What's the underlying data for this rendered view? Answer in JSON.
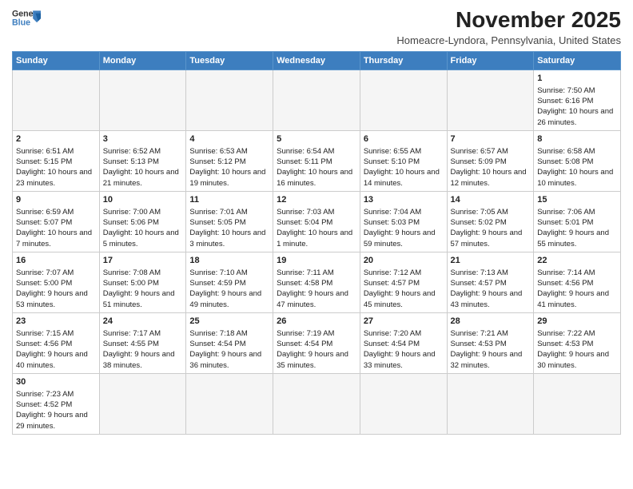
{
  "header": {
    "logo_line1": "General",
    "logo_line2": "Blue",
    "main_title": "November 2025",
    "subtitle": "Homeacre-Lyndora, Pennsylvania, United States"
  },
  "weekdays": [
    "Sunday",
    "Monday",
    "Tuesday",
    "Wednesday",
    "Thursday",
    "Friday",
    "Saturday"
  ],
  "weeks": [
    [
      {
        "day": "",
        "info": ""
      },
      {
        "day": "",
        "info": ""
      },
      {
        "day": "",
        "info": ""
      },
      {
        "day": "",
        "info": ""
      },
      {
        "day": "",
        "info": ""
      },
      {
        "day": "",
        "info": ""
      },
      {
        "day": "1",
        "info": "Sunrise: 7:50 AM\nSunset: 6:16 PM\nDaylight: 10 hours\nand 26 minutes."
      }
    ],
    [
      {
        "day": "2",
        "info": "Sunrise: 6:51 AM\nSunset: 5:15 PM\nDaylight: 10 hours\nand 23 minutes."
      },
      {
        "day": "3",
        "info": "Sunrise: 6:52 AM\nSunset: 5:13 PM\nDaylight: 10 hours\nand 21 minutes."
      },
      {
        "day": "4",
        "info": "Sunrise: 6:53 AM\nSunset: 5:12 PM\nDaylight: 10 hours\nand 19 minutes."
      },
      {
        "day": "5",
        "info": "Sunrise: 6:54 AM\nSunset: 5:11 PM\nDaylight: 10 hours\nand 16 minutes."
      },
      {
        "day": "6",
        "info": "Sunrise: 6:55 AM\nSunset: 5:10 PM\nDaylight: 10 hours\nand 14 minutes."
      },
      {
        "day": "7",
        "info": "Sunrise: 6:57 AM\nSunset: 5:09 PM\nDaylight: 10 hours\nand 12 minutes."
      },
      {
        "day": "8",
        "info": "Sunrise: 6:58 AM\nSunset: 5:08 PM\nDaylight: 10 hours\nand 10 minutes."
      }
    ],
    [
      {
        "day": "9",
        "info": "Sunrise: 6:59 AM\nSunset: 5:07 PM\nDaylight: 10 hours\nand 7 minutes."
      },
      {
        "day": "10",
        "info": "Sunrise: 7:00 AM\nSunset: 5:06 PM\nDaylight: 10 hours\nand 5 minutes."
      },
      {
        "day": "11",
        "info": "Sunrise: 7:01 AM\nSunset: 5:05 PM\nDaylight: 10 hours\nand 3 minutes."
      },
      {
        "day": "12",
        "info": "Sunrise: 7:03 AM\nSunset: 5:04 PM\nDaylight: 10 hours\nand 1 minute."
      },
      {
        "day": "13",
        "info": "Sunrise: 7:04 AM\nSunset: 5:03 PM\nDaylight: 9 hours\nand 59 minutes."
      },
      {
        "day": "14",
        "info": "Sunrise: 7:05 AM\nSunset: 5:02 PM\nDaylight: 9 hours\nand 57 minutes."
      },
      {
        "day": "15",
        "info": "Sunrise: 7:06 AM\nSunset: 5:01 PM\nDaylight: 9 hours\nand 55 minutes."
      }
    ],
    [
      {
        "day": "16",
        "info": "Sunrise: 7:07 AM\nSunset: 5:00 PM\nDaylight: 9 hours\nand 53 minutes."
      },
      {
        "day": "17",
        "info": "Sunrise: 7:08 AM\nSunset: 5:00 PM\nDaylight: 9 hours\nand 51 minutes."
      },
      {
        "day": "18",
        "info": "Sunrise: 7:10 AM\nSunset: 4:59 PM\nDaylight: 9 hours\nand 49 minutes."
      },
      {
        "day": "19",
        "info": "Sunrise: 7:11 AM\nSunset: 4:58 PM\nDaylight: 9 hours\nand 47 minutes."
      },
      {
        "day": "20",
        "info": "Sunrise: 7:12 AM\nSunset: 4:57 PM\nDaylight: 9 hours\nand 45 minutes."
      },
      {
        "day": "21",
        "info": "Sunrise: 7:13 AM\nSunset: 4:57 PM\nDaylight: 9 hours\nand 43 minutes."
      },
      {
        "day": "22",
        "info": "Sunrise: 7:14 AM\nSunset: 4:56 PM\nDaylight: 9 hours\nand 41 minutes."
      }
    ],
    [
      {
        "day": "23",
        "info": "Sunrise: 7:15 AM\nSunset: 4:56 PM\nDaylight: 9 hours\nand 40 minutes."
      },
      {
        "day": "24",
        "info": "Sunrise: 7:17 AM\nSunset: 4:55 PM\nDaylight: 9 hours\nand 38 minutes."
      },
      {
        "day": "25",
        "info": "Sunrise: 7:18 AM\nSunset: 4:54 PM\nDaylight: 9 hours\nand 36 minutes."
      },
      {
        "day": "26",
        "info": "Sunrise: 7:19 AM\nSunset: 4:54 PM\nDaylight: 9 hours\nand 35 minutes."
      },
      {
        "day": "27",
        "info": "Sunrise: 7:20 AM\nSunset: 4:54 PM\nDaylight: 9 hours\nand 33 minutes."
      },
      {
        "day": "28",
        "info": "Sunrise: 7:21 AM\nSunset: 4:53 PM\nDaylight: 9 hours\nand 32 minutes."
      },
      {
        "day": "29",
        "info": "Sunrise: 7:22 AM\nSunset: 4:53 PM\nDaylight: 9 hours\nand 30 minutes."
      }
    ],
    [
      {
        "day": "30",
        "info": "Sunrise: 7:23 AM\nSunset: 4:52 PM\nDaylight: 9 hours\nand 29 minutes."
      },
      {
        "day": "",
        "info": ""
      },
      {
        "day": "",
        "info": ""
      },
      {
        "day": "",
        "info": ""
      },
      {
        "day": "",
        "info": ""
      },
      {
        "day": "",
        "info": ""
      },
      {
        "day": "",
        "info": ""
      }
    ]
  ]
}
